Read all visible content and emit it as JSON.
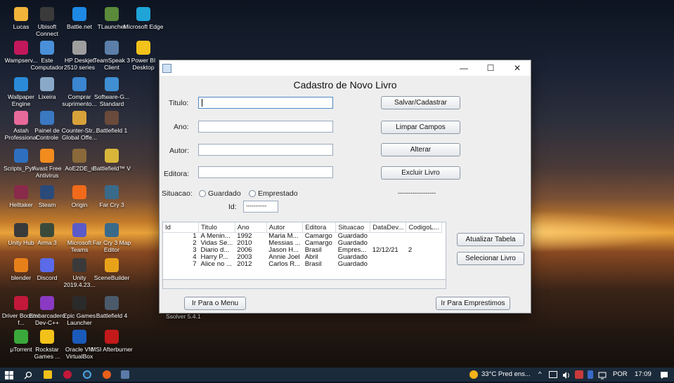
{
  "desktop": {
    "icons": [
      {
        "label": "Lucas",
        "color": "#f0b43a"
      },
      {
        "label": "Ubisoft Connect",
        "color": "#3a3a3a"
      },
      {
        "label": "Battle.net",
        "color": "#1e88e5"
      },
      {
        "label": "TLauncher",
        "color": "#5a8a3a"
      },
      {
        "label": "Microsoft Edge",
        "color": "#1fa4d8"
      },
      {
        "label": "Wampserv...",
        "color": "#c2185b"
      },
      {
        "label": "Este Computador",
        "color": "#4a90d9"
      },
      {
        "label": "HP Deskjet 2510 series",
        "color": "#9e9e9e"
      },
      {
        "label": "TeamSpeak 3 Client",
        "color": "#5b7fa8"
      },
      {
        "label": "Wallpaper Engine",
        "color": "#2b8ad8"
      },
      {
        "label": "Lixeira",
        "color": "#8aa9c8"
      },
      {
        "label": "Comprar suprimento...",
        "color": "#3a86d0"
      },
      {
        "label": "Software-G... Standard",
        "color": "#3f8fd2"
      },
      {
        "label": "Astah Professional",
        "color": "#e86a9a"
      },
      {
        "label": "Painel de Controle",
        "color": "#3a78c2"
      },
      {
        "label": "Counter-Str... Global Offe...",
        "color": "#d8a23a"
      },
      {
        "label": "Battlefield 1",
        "color": "#6a4a3a"
      },
      {
        "label": "Scripts_Pyt...",
        "color": "#2e6fbf"
      },
      {
        "label": "Avast Free Antivirus",
        "color": "#f28c1f"
      },
      {
        "label": "AoE2DE_s",
        "color": "#8a6a3a"
      },
      {
        "label": "Battlefield™ V",
        "color": "#d8b63a"
      },
      {
        "label": "Helltaker",
        "color": "#8a2a4a"
      },
      {
        "label": "Steam",
        "color": "#2a4a7a"
      },
      {
        "label": "Origin",
        "color": "#f06a1a"
      },
      {
        "label": "Far Cry 3",
        "color": "#3a6a8a"
      },
      {
        "label": "Unity Hub",
        "color": "#3a3a3a"
      },
      {
        "label": "Arma 3",
        "color": "#3a4a3a"
      },
      {
        "label": "Microsoft Teams",
        "color": "#5a5ac8"
      },
      {
        "label": "Far Cry 3 Map Editor",
        "color": "#3a6a8a"
      },
      {
        "label": "blender",
        "color": "#e8801a"
      },
      {
        "label": "Discord",
        "color": "#5a6ae8"
      },
      {
        "label": "Unity 2019.4.23...",
        "color": "#3a3a3a"
      },
      {
        "label": "SceneBuilder",
        "color": "#e8a21a"
      },
      {
        "label": "Driver Booster f...",
        "color": "#c2183a"
      },
      {
        "label": "Embarcadero Dev-C++",
        "color": "#8a3ac2"
      },
      {
        "label": "Epic Games Launcher",
        "color": "#2a2a2a"
      },
      {
        "label": "Battlefield 4",
        "color": "#4a5a6a"
      },
      {
        "label": "μTorrent",
        "color": "#3aa83a"
      },
      {
        "label": "Rockstar Games ...",
        "color": "#f2c21a"
      },
      {
        "label": "Oracle VM VirtualBox",
        "color": "#1a5ab8"
      },
      {
        "label": "MSI Afterburner",
        "color": "#c21a1a"
      },
      {
        "label": "Power BI Desktop",
        "color": "#f2c21a"
      }
    ],
    "partial_labels": {
      "ssolver": "Ssolver 5.4.1"
    }
  },
  "window": {
    "min_icon": "—",
    "max_icon": "☐",
    "close_icon": "✕",
    "title": "Cadastro de Novo Livro",
    "fields": {
      "titulo_label": "Titulo:",
      "ano_label": "Ano:",
      "autor_label": "Autor:",
      "editora_label": "Editora:",
      "situacao_label": "Situacao:",
      "id_label": "Id:",
      "id_value": "-----------"
    },
    "radios": {
      "guardado": "Guardado",
      "emprestado": "Emprestado"
    },
    "status_text": "------------------",
    "buttons": {
      "salvar": "Salvar/Cadastrar",
      "limpar": "Limpar Campos",
      "alterar": "Alterar",
      "excluir": "Excluir Livro",
      "atualizar": "Atualizar Tabela",
      "selecionar": "Selecionar Livro",
      "menu": "Ir Para o Menu",
      "emprestimos": "Ir Para Emprestimos"
    },
    "table": {
      "headers": [
        "Id",
        "Titulo",
        "Ano",
        "Autor",
        "Editora",
        "Situacao",
        "DataDev...",
        "CodigoL..."
      ],
      "rows": [
        {
          "id": "1",
          "titulo": "A Menin...",
          "ano": "1992",
          "autor": "Maria M...",
          "editora": "Camargo",
          "situacao": "Guardado",
          "datadev": "",
          "codigo": ""
        },
        {
          "id": "2",
          "titulo": "Vidas Se...",
          "ano": "2010",
          "autor": "Messias ...",
          "editora": "Camargo",
          "situacao": "Guardado",
          "datadev": "",
          "codigo": ""
        },
        {
          "id": "3",
          "titulo": "Diario d...",
          "ano": "2006",
          "autor": "Jason H...",
          "editora": "Brasil",
          "situacao": "Empres...",
          "datadev": "12/12/21",
          "codigo": "2"
        },
        {
          "id": "4",
          "titulo": "Harry P...",
          "ano": "2003",
          "autor": "Annie Joel",
          "editora": "Abril",
          "situacao": "Guardado",
          "datadev": "",
          "codigo": ""
        },
        {
          "id": "7",
          "titulo": "Alice no ...",
          "ano": "2012",
          "autor": "Carlos R...",
          "editora": "Brasil",
          "situacao": "Guardado",
          "datadev": "",
          "codigo": ""
        }
      ]
    }
  },
  "taskbar": {
    "weather": "33°C Pred ens...",
    "tray_arrow": "^",
    "language": "POR",
    "time": "17:09"
  }
}
